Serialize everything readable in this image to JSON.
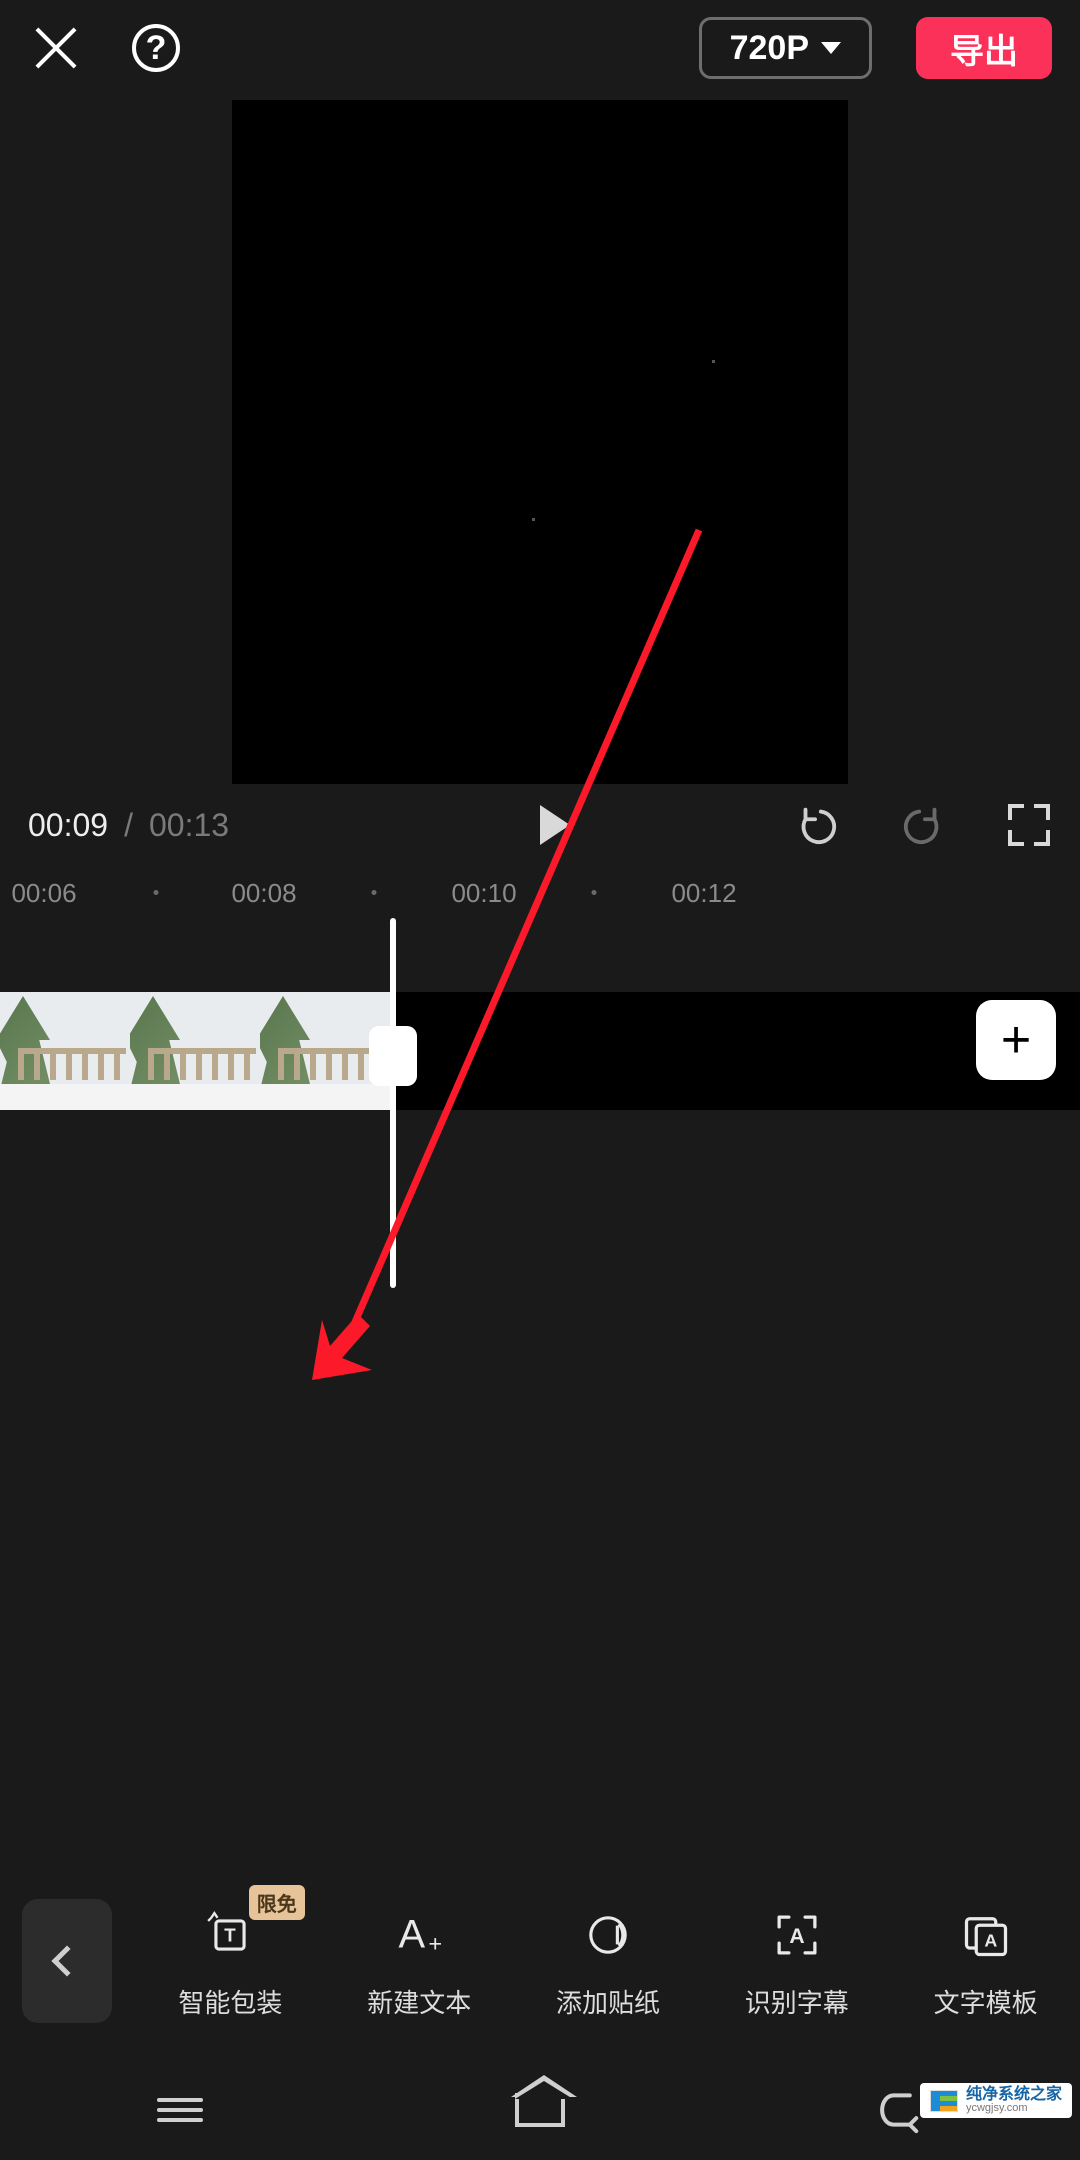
{
  "header": {
    "help_glyph": "?",
    "resolution_label": "720P",
    "export_label": "导出"
  },
  "playback": {
    "current_time": "00:09",
    "separator": "/",
    "total_time": "00:13"
  },
  "ruler": {
    "labels": [
      "00:06",
      "00:08",
      "00:10",
      "00:12"
    ]
  },
  "timeline": {
    "add_glyph": "+"
  },
  "tools": {
    "badge": "限免",
    "items": [
      {
        "id": "smart-package",
        "label": "智能包装"
      },
      {
        "id": "new-text",
        "label": "新建文本"
      },
      {
        "id": "add-sticker",
        "label": "添加贴纸"
      },
      {
        "id": "auto-caption",
        "label": "识别字幕"
      },
      {
        "id": "text-template",
        "label": "文字模板"
      }
    ]
  },
  "watermark": {
    "cn": "纯净系统之家",
    "en": "ycwgjsy.com"
  }
}
